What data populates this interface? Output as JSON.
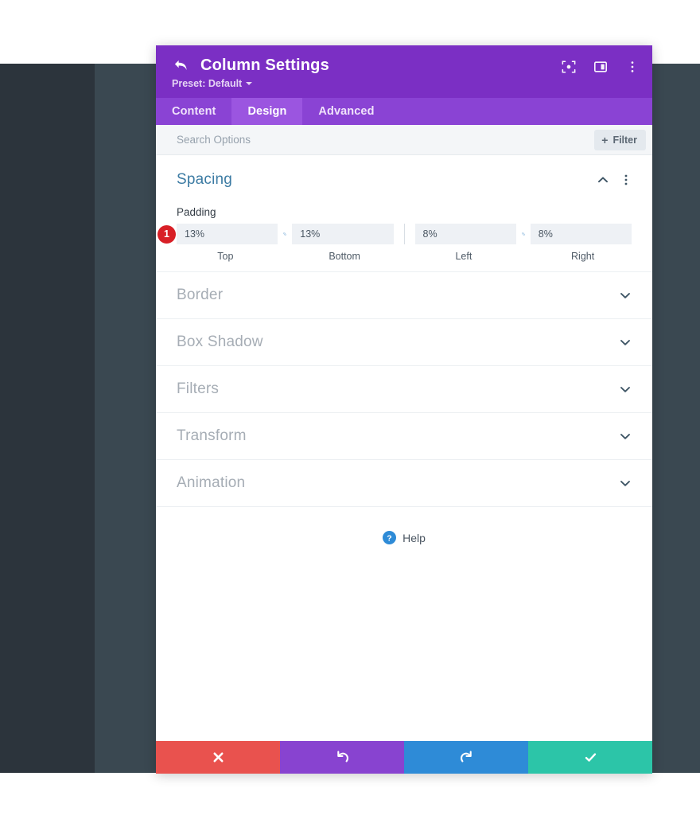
{
  "window": {
    "title": "Column Settings",
    "preset_label": "Preset: Default",
    "back_icon": "back-arrow-icon",
    "header_icons": [
      "focus-icon",
      "layout-panel-icon",
      "kebab-menu-icon"
    ]
  },
  "tabs": [
    {
      "label": "Content",
      "active": false
    },
    {
      "label": "Design",
      "active": true
    },
    {
      "label": "Advanced",
      "active": false
    }
  ],
  "search": {
    "placeholder": "Search Options",
    "value": "",
    "filter_label": "Filter",
    "filter_plus": "+"
  },
  "spacing": {
    "title": "Spacing",
    "collapse_icon": "chevron-up-icon",
    "menu_icon": "kebab-menu-icon",
    "padding_label": "Padding",
    "badge": "1",
    "fields": [
      {
        "name": "top",
        "value": "13%",
        "label": "Top"
      },
      {
        "name": "bottom",
        "value": "13%",
        "label": "Bottom"
      },
      {
        "name": "left",
        "value": "8%",
        "label": "Left"
      },
      {
        "name": "right",
        "value": "8%",
        "label": "Right"
      }
    ],
    "link_icon": "link-chain-icon"
  },
  "sections": [
    {
      "title": "Border",
      "icon": "chevron-down-icon"
    },
    {
      "title": "Box Shadow",
      "icon": "chevron-down-icon"
    },
    {
      "title": "Filters",
      "icon": "chevron-down-icon"
    },
    {
      "title": "Transform",
      "icon": "chevron-down-icon"
    },
    {
      "title": "Animation",
      "icon": "chevron-down-icon"
    }
  ],
  "help": {
    "label": "Help",
    "icon": "question-circle-icon"
  },
  "footer": {
    "buttons": [
      {
        "name": "cancel",
        "icon": "close-x-icon",
        "color": "#e9524e"
      },
      {
        "name": "undo",
        "icon": "undo-icon",
        "color": "#8843d0"
      },
      {
        "name": "redo",
        "icon": "redo-icon",
        "color": "#2e8bd7"
      },
      {
        "name": "save",
        "icon": "checkmark-icon",
        "color": "#2cc5a8"
      }
    ]
  },
  "colors": {
    "header_purple": "#7b2fc4",
    "tabbar_purple": "#8a43d4",
    "tab_active_purple": "#9b55e0",
    "section_open_blue": "#3c7ba3",
    "section_collapsed_gray": "#a6adb5",
    "badge_red": "#d81f26",
    "bg_dark_left": "#2c343c",
    "bg_dark_right": "#3a4851"
  }
}
